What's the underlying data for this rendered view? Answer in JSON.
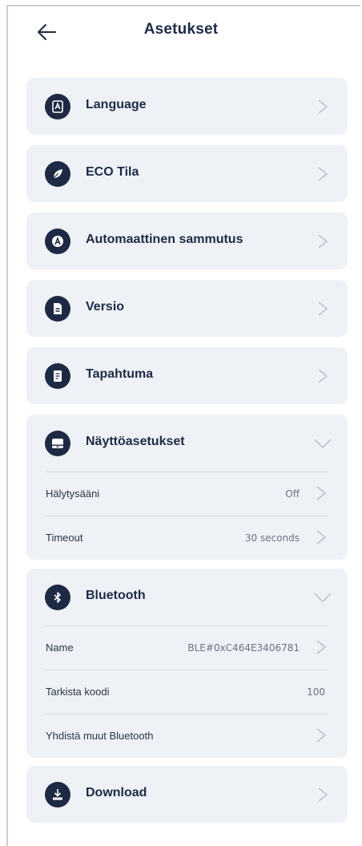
{
  "header": {
    "title": "Asetukset",
    "back_icon": "arrow-left-icon"
  },
  "colors": {
    "accent": "#1e2a44",
    "card_bg": "#eef2f7",
    "chevron": "#b9c0ca"
  },
  "menu": {
    "language": {
      "label": "Language",
      "icon": "translate-icon"
    },
    "eco": {
      "label": "ECO Tila",
      "icon": "leaf-icon"
    },
    "auto_off": {
      "label": "Automaattinen sammutus",
      "icon": "auto-icon"
    },
    "version": {
      "label": "Versio",
      "icon": "document-icon"
    },
    "event": {
      "label": "Tapahtuma",
      "icon": "log-icon"
    },
    "display": {
      "label": "Näyttöasetukset",
      "icon": "display-icon",
      "items": [
        {
          "label": "Hälytysääni",
          "value": "Off"
        },
        {
          "label": "Timeout",
          "value": "30 seconds"
        }
      ]
    },
    "bluetooth": {
      "label": "Bluetooth",
      "icon": "bluetooth-icon",
      "items": [
        {
          "label": "Name",
          "value": "BLE#0xC464E3406781"
        },
        {
          "label": "Tarkista koodi",
          "value": "100"
        },
        {
          "label": "Yhdistä muut Bluetooth",
          "value": ""
        }
      ]
    },
    "download": {
      "label": "Download",
      "icon": "download-icon"
    }
  }
}
